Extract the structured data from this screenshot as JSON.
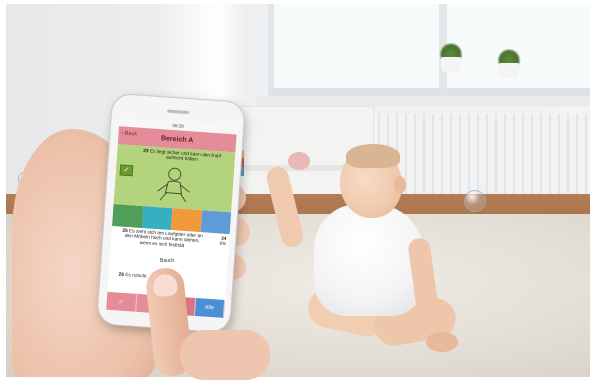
{
  "app": {
    "status_time": "09:28",
    "back_label": "‹ Back",
    "title": "Bereich A"
  },
  "items": [
    {
      "number": "23",
      "text": "Es liegt sicher und kann den Kopf aufrecht halten"
    },
    {
      "number": "24",
      "side_label": "24",
      "side_note": "6%"
    },
    {
      "number": "25",
      "text": "Es zieht sich am Laufgitter oder an den Möbeln hoch und kann stehen, wenn es sich festhält"
    },
    {
      "number": "26",
      "text": "Es rutscht",
      "suffix": "Bauch"
    }
  ],
  "color_scale": [
    "#4f9e5a",
    "#34b0c0",
    "#f29a3a",
    "#5f9bd6"
  ],
  "toolbar": {
    "check_icon": "✓",
    "circle_icon": "○",
    "alle_label": "Alle"
  },
  "icons": [
    "check-icon",
    "circle-icon",
    "back-chevron-icon"
  ]
}
